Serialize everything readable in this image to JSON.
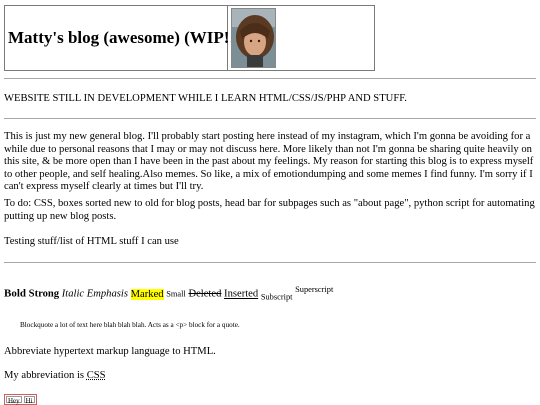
{
  "header": {
    "title": "Matty's blog (awesome) (WIP!!!)",
    "avatar_alt": "profile photo"
  },
  "notice": "WEBSITE STILL IN DEVELOPMENT WHILE I LEARN HTML/CSS/JS/PHP AND STUFF.",
  "intro": "This is just my new general blog. I'll probably start posting here instead of my instagram, which I'm gonna be avoiding for a while due to personal reasons that I may or may not discuss here. More likely than not I'm gonna be sharing quite heavily on this site, & be more open than I have been in the past about my feelings. My reason for starting this blog is to express myself to other people, and self healing.Also memes. So like, a mix of emotiondumping and some memes I find funny. I'm sorry if I can't express myself clearly at times but I'll try.",
  "todo": "To do: CSS, boxes sorted new to old for blog posts, head bar for subpages such as \"about page\", python script for automating putting up new blog posts.",
  "testing_heading": "Testing stuff/list of HTML stuff I can use",
  "formatting": {
    "bold": "Bold",
    "strong": "Strong",
    "italic": "Italic",
    "emphasis": "Emphasis",
    "marked": "Marked",
    "small": "Small",
    "deleted": "Deleted",
    "inserted": "Inserted",
    "subscript": "Subscript",
    "superscript": "Superscript"
  },
  "blockquote": "Blockquote a lot of text here blah blah blah. Acts as a <p> block for a quote.",
  "abbrev_sentence": "Abbreviate hypertext markup language to HTML.",
  "abbreviation": {
    "prefix": "My abbreviation is ",
    "term": "CSS"
  },
  "hello_box": [
    "Hey",
    "Hi"
  ]
}
